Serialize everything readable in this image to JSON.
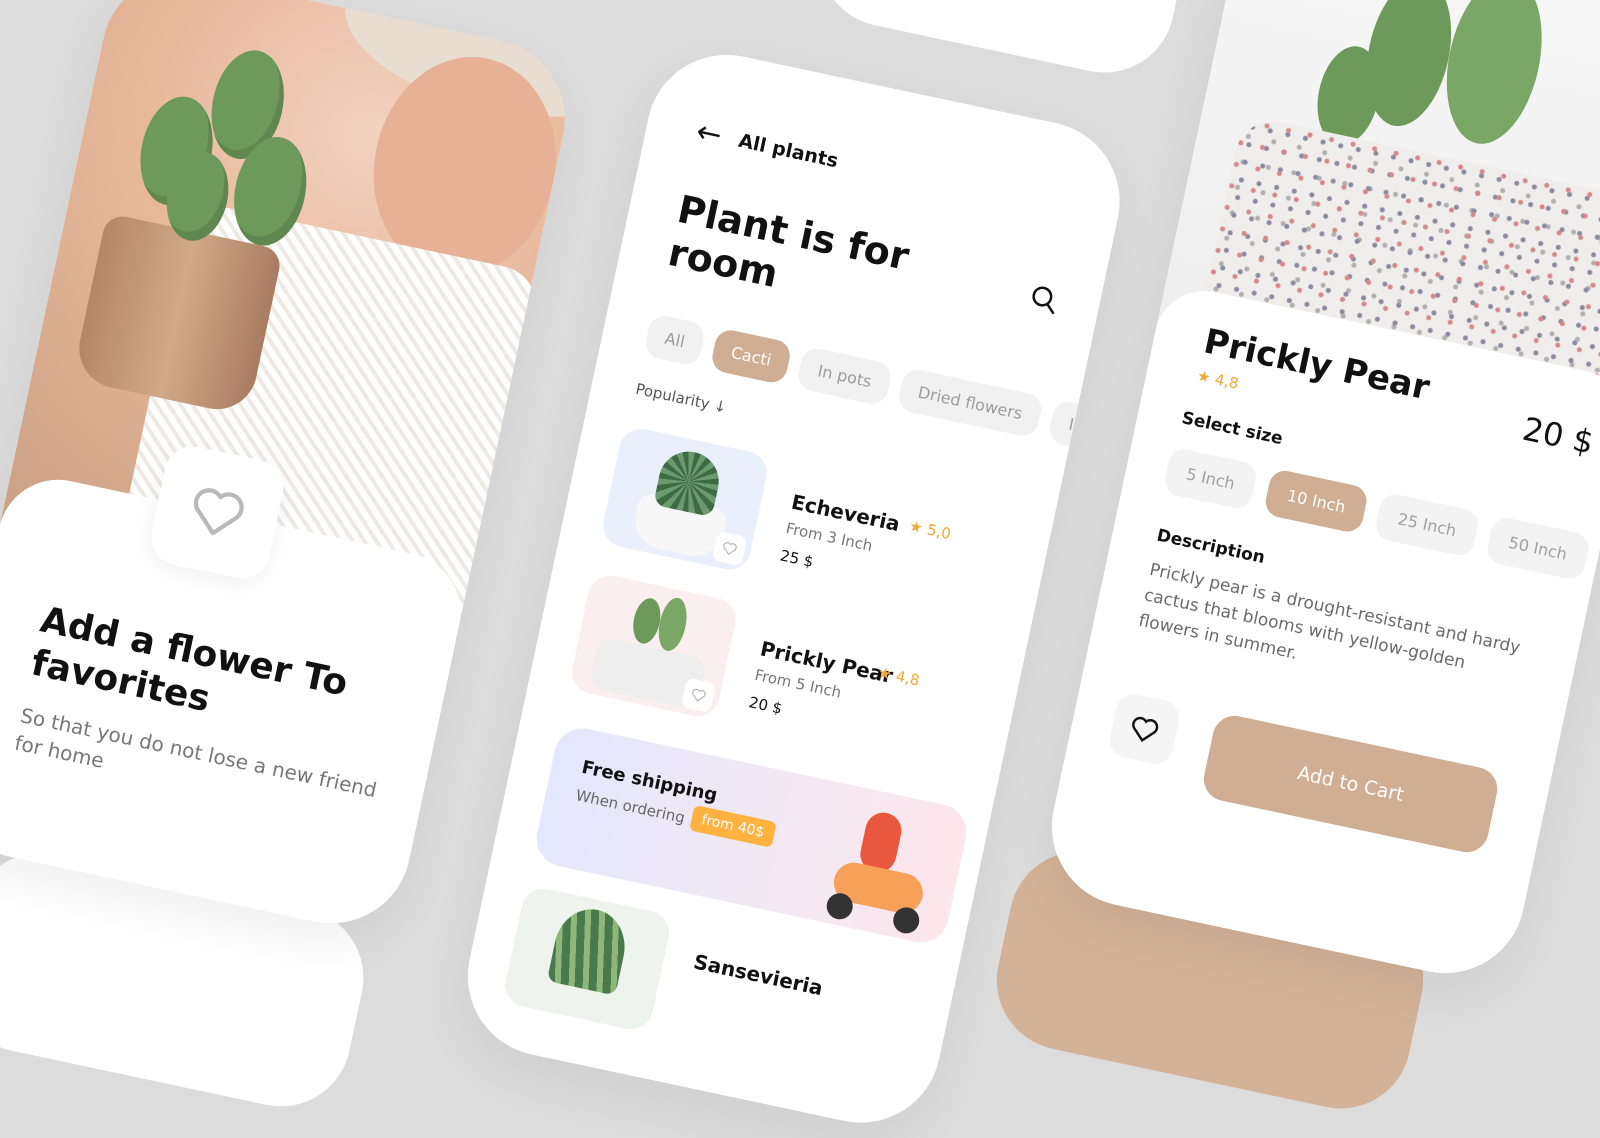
{
  "favorites_screen": {
    "title": "Add a flower To favorites",
    "subtitle": "So that you do not lose a new friend for home",
    "icons": {
      "favorite": "heart-outline-icon"
    }
  },
  "listing_screen": {
    "back_label": "All plants",
    "title": "Plant is for room",
    "icons": {
      "back": "arrow-left-icon",
      "search": "search-icon"
    },
    "categories": [
      {
        "label": "All",
        "active": false
      },
      {
        "label": "Cacti",
        "active": true
      },
      {
        "label": "In pots",
        "active": false
      },
      {
        "label": "Dried flowers",
        "active": false
      },
      {
        "label": "In",
        "active": false
      }
    ],
    "sort_label": "Popularity ↓",
    "products": [
      {
        "name": "Echeveria",
        "subtitle": "From 3 Inch",
        "price": "25 $",
        "rating": "★ 5,0"
      },
      {
        "name": "Prickly Pear",
        "subtitle": "From 5 Inch",
        "price": "20 $",
        "rating": "★ 4,8"
      },
      {
        "name": "Sansevieria",
        "subtitle": "",
        "price": "",
        "rating": ""
      }
    ],
    "banner": {
      "title": "Free shipping",
      "subtitle": "When ordering",
      "badge": "from 40$"
    }
  },
  "detail_screen": {
    "name": "Prickly Pear",
    "rating": "★ 4,8",
    "price": "20 $",
    "size_label": "Select size",
    "sizes": [
      {
        "label": "5 Inch",
        "active": false
      },
      {
        "label": "10 Inch",
        "active": true
      },
      {
        "label": "25 Inch",
        "active": false
      },
      {
        "label": "50 Inch",
        "active": false
      }
    ],
    "description_label": "Description",
    "description": "Prickly pear is a drought-resistant and hardy cactus that blooms with yellow-golden flowers in summer.",
    "cart_label": "Add to Cart"
  },
  "colors": {
    "accent": "#cfae93",
    "rating": "#f0a838",
    "badge": "#ffb23f",
    "background": "#dcdcdc"
  }
}
